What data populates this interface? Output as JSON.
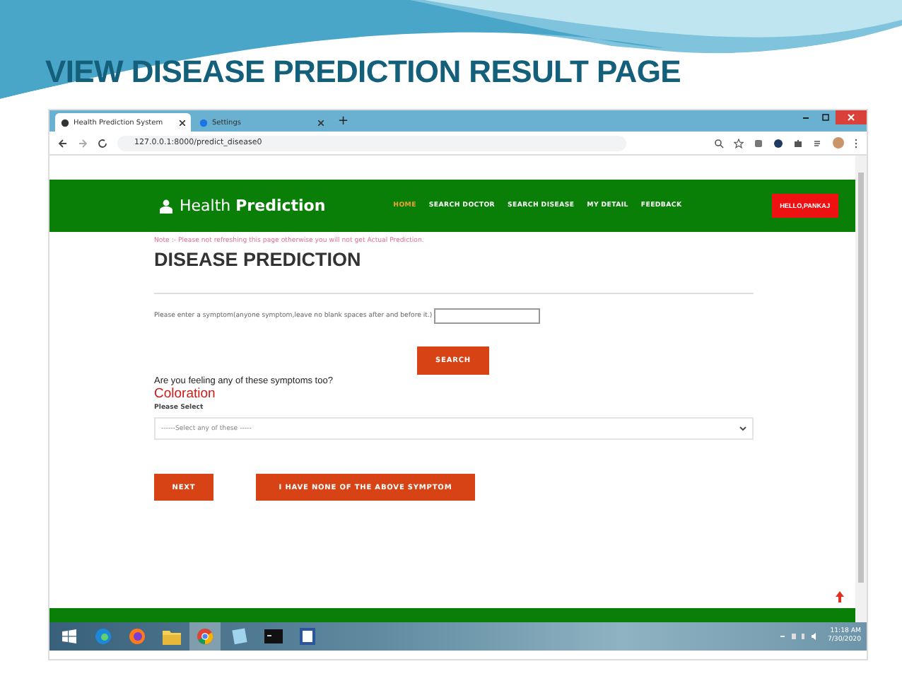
{
  "slide_title": "VIEW DISEASE PREDICTION RESULT PAGE",
  "browser": {
    "tabs": [
      {
        "title": "Health Prediction System",
        "selected": true
      },
      {
        "title": "Settings",
        "selected": false
      }
    ],
    "new_tab": "+",
    "url": "127.0.0.1:8000/predict_disease0"
  },
  "page": {
    "brand": "Health **Prediction**",
    "nav": [
      {
        "label": "HOME",
        "selected": true
      },
      {
        "label": "SEARCH DOCTOR",
        "selected": false
      },
      {
        "label": "SEARCH DISEASE",
        "selected": false
      },
      {
        "label": "MY DETAIL",
        "selected": false
      },
      {
        "label": "FEEDBACK",
        "selected": false
      }
    ],
    "user_button": "HELLO,PANKAJ",
    "note": "Note :- Please not refreshing this page otherwise you will not get Actual Prediction.",
    "heading": "DISEASE PREDICTION",
    "symptom_label": "Please enter a symptom(anyone symptom,leave no blank spaces after and before it.)",
    "search_button": "SEARCH",
    "question": "Are you feeling any of these symptoms too?",
    "symptom_name": "Coloration",
    "select_label": "Please Select",
    "select_placeholder": "------Select any of these -----",
    "buttons": [
      "NEXT",
      "I HAVE NONE OF THE ABOVE SYMPTOM"
    ]
  },
  "taskbar": {
    "apps": [
      {
        "kind": "edge",
        "selected": false
      },
      {
        "kind": "firefox",
        "selected": false
      },
      {
        "kind": "folder",
        "selected": false
      },
      {
        "kind": "chrome",
        "selected": true
      },
      {
        "kind": "notepad",
        "selected": false
      },
      {
        "kind": "terminal",
        "selected": false
      },
      {
        "kind": "document",
        "selected": false
      }
    ],
    "time": "11:18 AM",
    "date": "7/30/2020"
  }
}
